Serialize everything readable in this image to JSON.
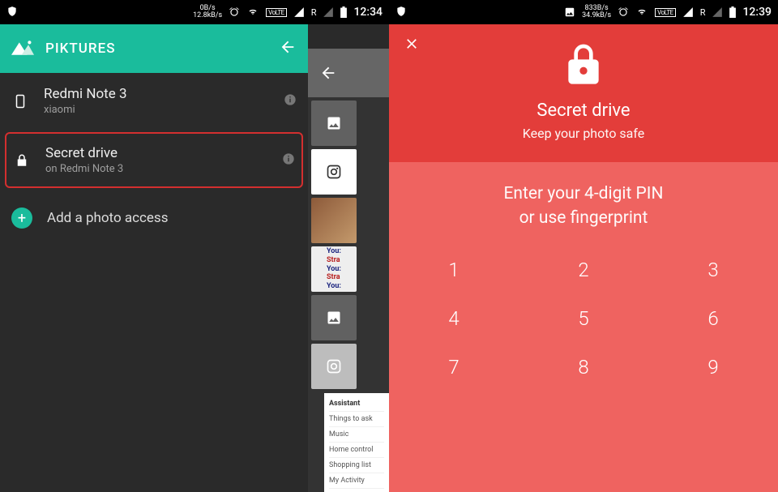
{
  "left": {
    "status": {
      "speed": "0B/s\n12.8kB/s",
      "volte": "VoLTE",
      "r": "R",
      "time": "12:34"
    },
    "appbar": {
      "title": "PIKTURES"
    },
    "devices": [
      {
        "title": "Redmi Note 3",
        "subtitle": "xiaomi"
      },
      {
        "title": "Secret drive",
        "subtitle": "on Redmi Note 3"
      }
    ],
    "add_label": "Add a photo access",
    "peek_chat": {
      "l1a": "You:",
      "l1b": "Stra",
      "l2a": "You:",
      "l2b": "Stra",
      "l3a": "You:"
    },
    "peek_menu": {
      "header": "Assistant",
      "items": [
        "Things to ask",
        "Music",
        "Home control",
        "Shopping list",
        "My Activity"
      ]
    }
  },
  "right": {
    "status": {
      "speed": "833B/s\n34.9kB/s",
      "volte": "VoLTE",
      "r": "R",
      "time": "12:39"
    },
    "header": {
      "title": "Secret drive",
      "subtitle": "Keep your photo safe"
    },
    "prompt": {
      "line1": "Enter your 4-digit PIN",
      "line2": "or use fingerprint"
    },
    "keys": [
      "1",
      "2",
      "3",
      "4",
      "5",
      "6",
      "7",
      "8",
      "9"
    ]
  }
}
